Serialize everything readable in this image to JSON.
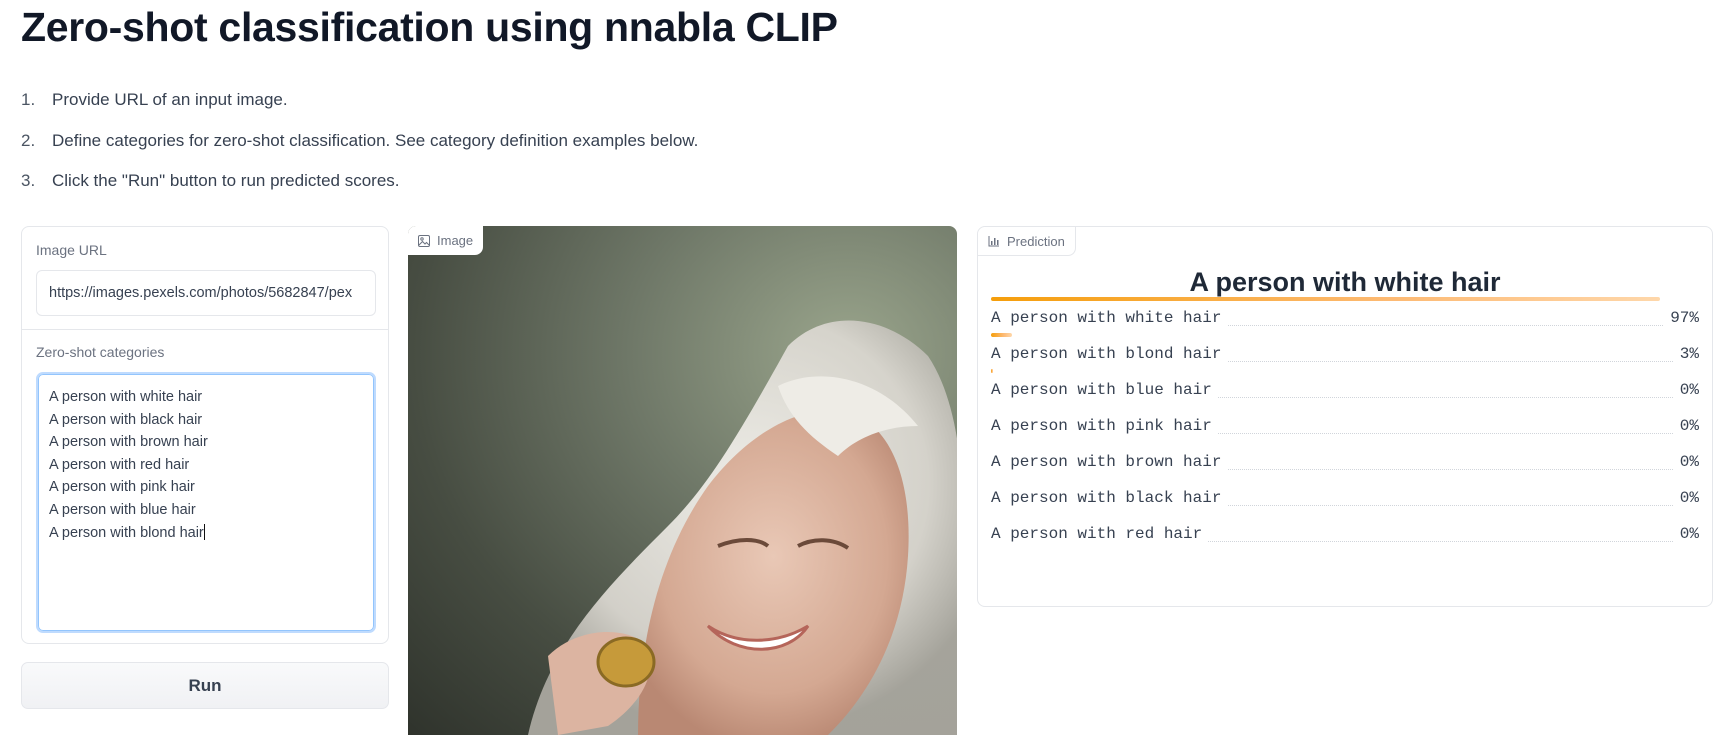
{
  "page": {
    "title": "Zero-shot classification using nnabla CLIP",
    "steps": [
      {
        "num": "1.",
        "text": "Provide URL of an input image."
      },
      {
        "num": "2.",
        "text": "Define categories for zero-shot classification. See category definition examples below."
      },
      {
        "num": "3.",
        "text": "Click the \"Run\" button to run predicted scores."
      }
    ]
  },
  "inputs": {
    "url_label": "Image URL",
    "url_value": "https://images.pexels.com/photos/5682847/pex",
    "categories_label": "Zero-shot categories",
    "categories": [
      "A person with white hair",
      "A person with black hair",
      "A person with brown hair",
      "A person with red hair",
      "A person with pink hair",
      "A person with blue hair",
      "A person with blond hair"
    ],
    "run_label": "Run"
  },
  "image_panel": {
    "tab_label": "Image",
    "icon": "image-icon"
  },
  "prediction": {
    "tab_label": "Prediction",
    "icon": "bar-chart-icon",
    "top_label": "A person with white hair",
    "rows": [
      {
        "label": "A person with white hair",
        "pct": "97%",
        "value": 0.97
      },
      {
        "label": "A person with blond hair",
        "pct": "3%",
        "value": 0.03
      },
      {
        "label": "A person with blue hair",
        "pct": "0%",
        "value": 0.002
      },
      {
        "label": "A person with pink hair",
        "pct": "0%",
        "value": 0.0
      },
      {
        "label": "A person with brown hair",
        "pct": "0%",
        "value": 0.0
      },
      {
        "label": "A person with black hair",
        "pct": "0%",
        "value": 0.0
      },
      {
        "label": "A person with red hair",
        "pct": "0%",
        "value": 0.0
      }
    ],
    "bar_color": "#f59e0b"
  }
}
